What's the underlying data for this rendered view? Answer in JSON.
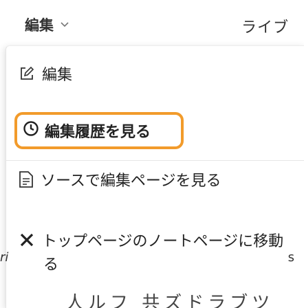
{
  "toolbar": {
    "edit_label": "編集",
    "live_label": "ライブ"
  },
  "menu": {
    "edit_label": "編集",
    "history_label": "編集履歴を見る",
    "source_label": "ソースで編集ページを見る",
    "talk_label": "トップページのノートページに移動",
    "talk_label_cont": "る"
  },
  "background": {
    "peek_left": "ri",
    "peek_right": "s",
    "heading_partial": "人ルフ 共ズドラブツ"
  },
  "colors": {
    "highlight": "#f29b2b"
  },
  "icons": {
    "edit": "pencil-square-icon",
    "history": "clock-icon",
    "source": "document-icon",
    "talk": "x-mark-icon",
    "dropdown": "chevron-down-icon"
  }
}
